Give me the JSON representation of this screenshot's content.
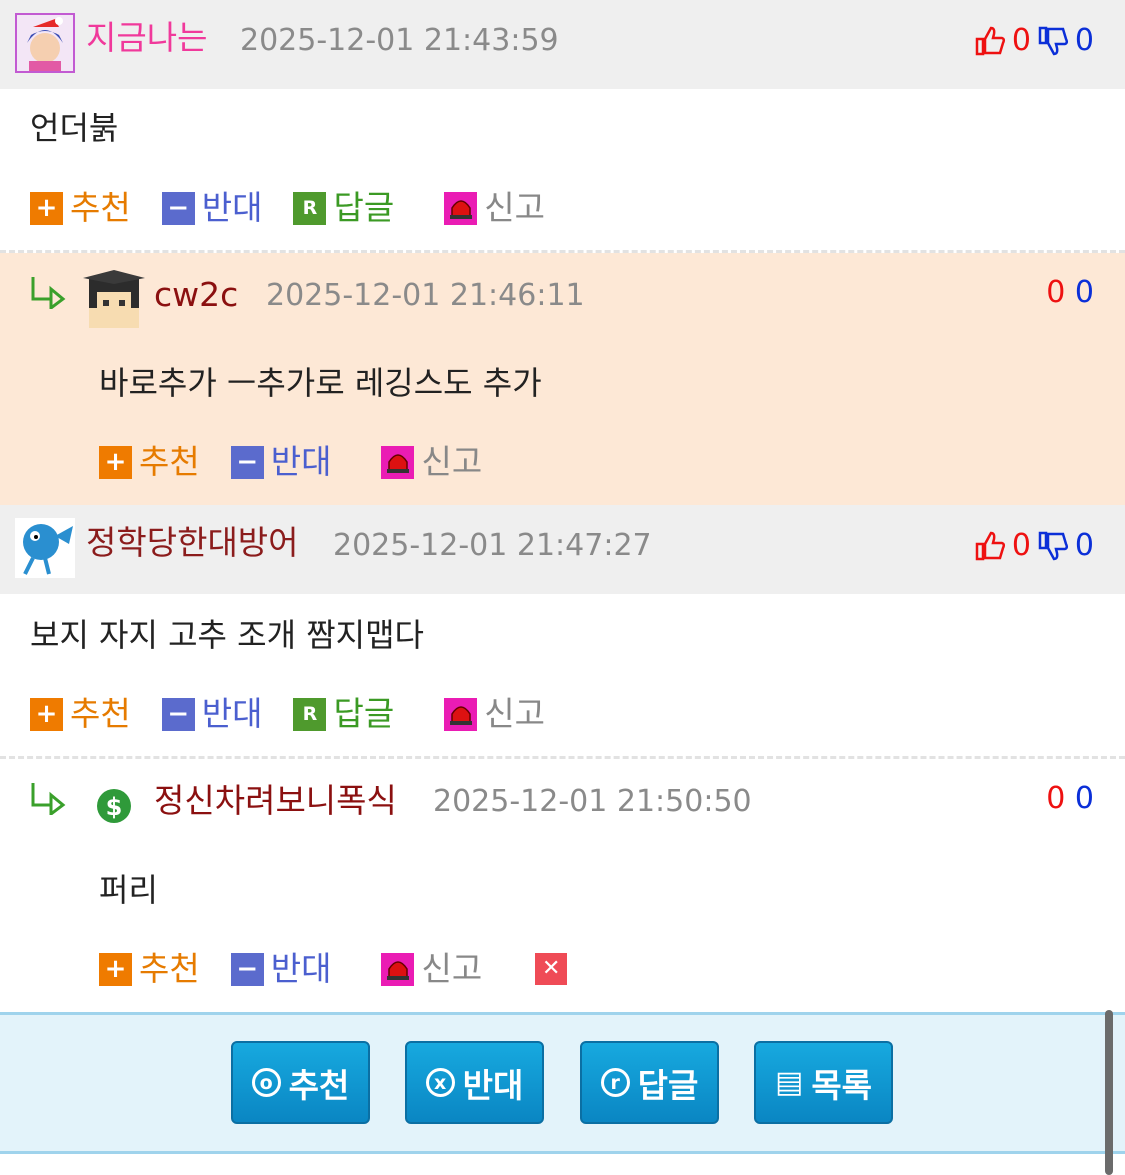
{
  "comments": [
    {
      "author": "지금나는",
      "author_color": "#f0399b",
      "time": "2025-12-01 21:43:59",
      "up": "0",
      "down": "0",
      "text": "언더붉"
    },
    {
      "author": "정학당한대방어",
      "author_color": "#8b1c1c",
      "time": "2025-12-01 21:47:27",
      "up": "0",
      "down": "0",
      "text": "보지 자지 고추 조개 짬지맵다"
    }
  ],
  "replies": [
    {
      "author": "cw2c",
      "author_color": "#8b1010",
      "time": "2025-12-01 21:46:11",
      "up": "0",
      "down": "0",
      "text": "바로추가 ㅡ추가로 레깅스도 추가"
    },
    {
      "author": "정신차려보니폭식",
      "author_color": "#8b1010",
      "time": "2025-12-01 21:50:50",
      "up": "0",
      "down": "0",
      "text": "퍼리"
    }
  ],
  "actions": {
    "recommend": "추천",
    "oppose": "반대",
    "reply": "답글",
    "report": "신고",
    "reply_icon_letter": "R",
    "del_icon": "✕"
  },
  "bottom": {
    "recommend": "추천",
    "oppose": "반대",
    "reply": "답글",
    "list": "목록",
    "rec_icon": "o",
    "opp_icon": "x",
    "rep_icon": "r",
    "list_icon": "▤"
  },
  "colors": {
    "reply_bg": "#fde8d6",
    "head_bg": "#efefef",
    "bottom_bg": "#e3f3fa",
    "button_blue": "#0f98d2"
  }
}
